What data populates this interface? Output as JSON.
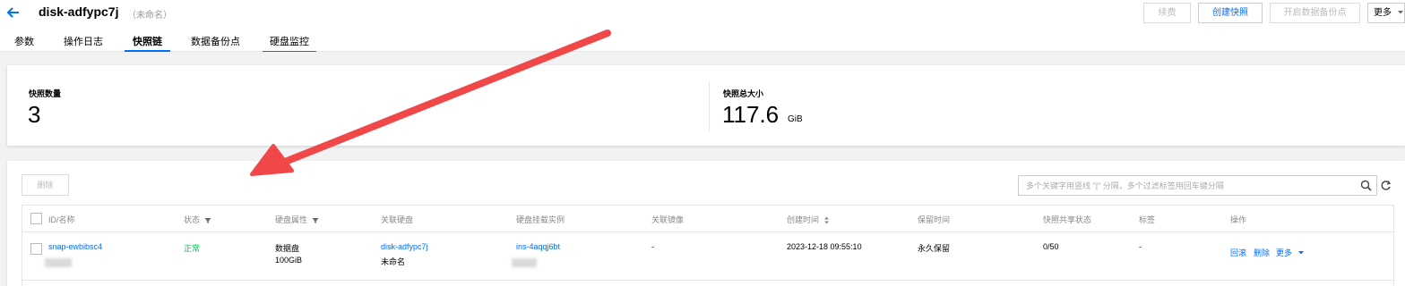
{
  "header": {
    "title": "disk-adfypc7j",
    "subtitle": "（未命名）",
    "buttons": {
      "renew": "续费",
      "create_snapshot": "创建快照",
      "enable_backup_point": "开启数据备份点",
      "more": "更多"
    },
    "tabs": [
      "参数",
      "操作日志",
      "快照链",
      "数据备份点",
      "硬盘监控"
    ],
    "active_tab": "快照链"
  },
  "stats": {
    "count_label": "快照数量",
    "count_value": "3",
    "size_label": "快照总大小",
    "size_value": "117.6",
    "size_unit": "GiB"
  },
  "toolbar": {
    "delete_label": "删除",
    "search_placeholder": "多个关键字用竖线 \"|\" 分隔，多个过滤标签用回车键分隔"
  },
  "table": {
    "columns": [
      "ID/名称",
      "状态",
      "硬盘属性",
      "关联硬盘",
      "硬盘挂载实例",
      "关联镜像",
      "创建时间",
      "保留时间",
      "快照共享状态",
      "标签",
      "操作"
    ],
    "rows": [
      {
        "id": "snap-ewbibsc4",
        "status": "正常",
        "disk_type": "数据盘",
        "disk_size": "100GiB",
        "disk_id": "disk-adfypc7j",
        "disk_name": "未命名",
        "instance_id": "ins-4aqqj6bt",
        "image": "-",
        "created": "2023-12-18 09:55:10",
        "retention": "永久保留",
        "share": "0/50",
        "tags": "-",
        "actions": {
          "rollback": "回滚",
          "delete": "删除",
          "more": "更多"
        }
      }
    ]
  },
  "colors": {
    "accent": "#006eff",
    "success": "#0abf5b",
    "arrow": "#f04848"
  }
}
